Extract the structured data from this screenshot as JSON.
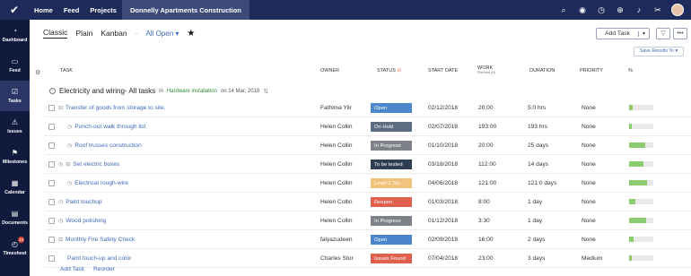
{
  "topbar": {
    "logo_icon": "checkmark-logo",
    "nav": [
      "Home",
      "Feed",
      "Projects",
      "Donnelly Apartments Construction"
    ],
    "icons": [
      "search-icon",
      "gamepad-icon",
      "timer-icon",
      "add-icon",
      "bell-icon",
      "tools-icon"
    ]
  },
  "sidebar": {
    "items": [
      {
        "label": "Dashboard",
        "icon": "dashboard-icon"
      },
      {
        "label": "Feed",
        "icon": "feed-icon"
      },
      {
        "label": "Tasks",
        "icon": "tasks-icon"
      },
      {
        "label": "Issues",
        "icon": "issues-icon"
      },
      {
        "label": "Milestones",
        "icon": "milestones-icon"
      },
      {
        "label": "Calendar",
        "icon": "calendar-icon"
      },
      {
        "label": "Documents",
        "icon": "documents-icon"
      },
      {
        "label": "Timesheet",
        "icon": "timesheet-icon",
        "badge": "15"
      }
    ]
  },
  "views": {
    "tabs": [
      "Classic",
      "Plain",
      "Kanban"
    ],
    "separator": "-",
    "filter": "All Open",
    "add_task": "Add Task",
    "save_results": "Save Results To"
  },
  "columns": {
    "task": "TASK",
    "owner": "OWNER",
    "status": "STATUS",
    "start_date": "START DATE",
    "work": "WORK",
    "work_sub": "Planned (H)",
    "duration": "DURATION",
    "priority": "PRIORITY",
    "percent": "%"
  },
  "group": {
    "title": "Electricity and wiring- All tasks",
    "in_text": "in",
    "link": "Hardware installation",
    "on_text": "on 14 Mar, 2018"
  },
  "tasks": [
    {
      "name": "Transfer of goods from storage to site.",
      "owner": "Fathima Yilr",
      "status": "Open",
      "status_color": "#4a86c9",
      "start": "02/12/2018",
      "work": "20:00",
      "duration": "5:0 hrs",
      "priority": "None",
      "progress": 0.15,
      "expand": "⊟",
      "timer": false,
      "indent": 0
    },
    {
      "name": "Punch-out walk through list",
      "owner": "Helen Collin",
      "status": "On Hold",
      "status_color": "#5b6d7e",
      "start": "02/07/2018",
      "work": "193:00",
      "duration": "193 hrs",
      "priority": "None",
      "progress": 0.1,
      "expand": "",
      "timer": true,
      "indent": 1
    },
    {
      "name": "Roof trusses construction",
      "owner": "Helen Collin",
      "status": "In Progress",
      "status_color": "#7d8289",
      "start": "01/10/2018",
      "work": "20:00",
      "duration": "25 days",
      "priority": "None",
      "progress": 0.65,
      "expand": "",
      "timer": true,
      "indent": 1
    },
    {
      "name": "Set electric boxes",
      "owner": "Helen Collin",
      "status": "To be tested",
      "status_color": "#2f3e52",
      "start": "03/18/2018",
      "work": "112:00",
      "duration": "14 days",
      "priority": "None",
      "progress": 0.6,
      "expand": "⊟",
      "timer": true,
      "indent": 0
    },
    {
      "name": "Electrical rough-wire",
      "owner": "Helen Collin",
      "status": "Level 2 Tec...",
      "status_color": "#f0c27b",
      "start": "04/06/2018",
      "work": "121:00",
      "duration": "121:0 days",
      "priority": "None",
      "progress": 0.75,
      "expand": "",
      "timer": true,
      "indent": 1
    },
    {
      "name": "Paint touchup",
      "owner": "Helen Collin",
      "status": "Reopen",
      "status_color": "#e0604f",
      "start": "01/03/2018",
      "work": "8:00",
      "duration": "1 day",
      "priority": "None",
      "progress": 0.25,
      "expand": "",
      "timer": true,
      "indent": 0
    },
    {
      "name": "Wood polishing",
      "owner": "Helen Collin",
      "status": "In Progress",
      "status_color": "#7d8289",
      "start": "01/12/2018",
      "work": "3:30",
      "duration": "1 day",
      "priority": "None",
      "progress": 0.7,
      "expand": "",
      "timer": true,
      "indent": 0
    },
    {
      "name": "Monthly Fire Safety Check",
      "owner": "faiyazudeen",
      "status": "Open",
      "status_color": "#4a86c9",
      "start": "02/09/2018",
      "work": "16:00",
      "duration": "2 days",
      "priority": "None",
      "progress": 0.2,
      "expand": "⊟",
      "timer": false,
      "indent": 0
    },
    {
      "name": "Paint touch-up and color",
      "owner": "Charles Stor",
      "status": "Issues Found",
      "status_color": "#e0604f",
      "start": "07/04/2018",
      "work": "23:00",
      "duration": "3 days",
      "priority": "Medium",
      "progress": 0.12,
      "expand": "",
      "timer": false,
      "indent": 1
    }
  ],
  "footer": {
    "add_task": "Add Task",
    "reorder": "Reorder"
  }
}
